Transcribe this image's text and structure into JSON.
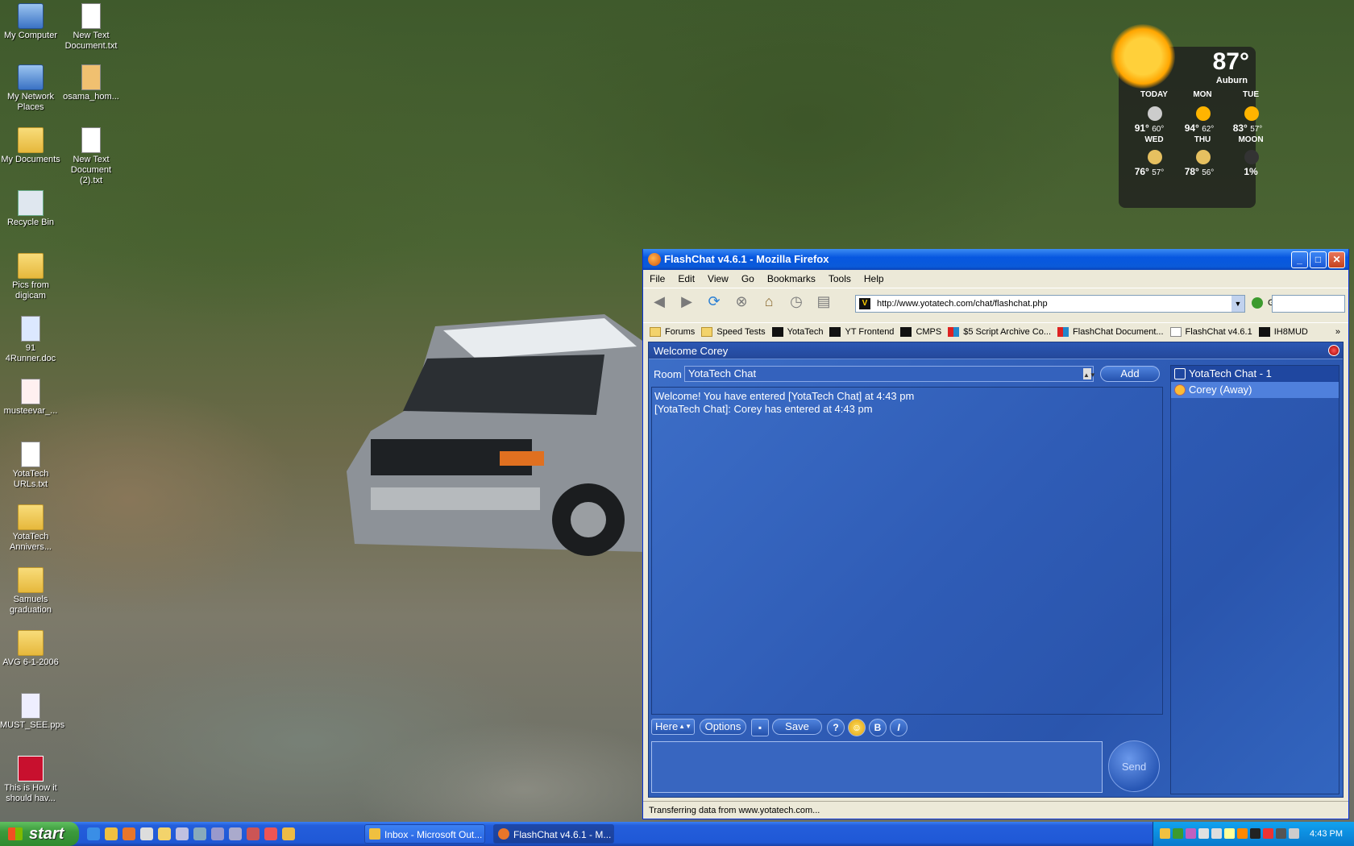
{
  "desktop": {
    "icons": [
      {
        "label": "My Computer"
      },
      {
        "label": "New Text Document.txt"
      },
      {
        "label": "My Network Places"
      },
      {
        "label": "osama_hom..."
      },
      {
        "label": "My Documents"
      },
      {
        "label": "New Text Document (2).txt"
      },
      {
        "label": "Recycle Bin"
      },
      {
        "label": "Pics from digicam"
      },
      {
        "label": "91 4Runner.doc"
      },
      {
        "label": "musteevar_..."
      },
      {
        "label": "YotaTech URLs.txt"
      },
      {
        "label": "YotaTech Annivers..."
      },
      {
        "label": "Samuels graduation"
      },
      {
        "label": "AVG 6-1-2006"
      },
      {
        "label": "MUST_SEE.pps"
      },
      {
        "label": "This is How it should hav..."
      }
    ]
  },
  "weather": {
    "current_temp": "87°",
    "location": "Auburn",
    "days": [
      {
        "name": "TODAY",
        "hi": "91°",
        "lo": "60°",
        "icon": "moon-icon"
      },
      {
        "name": "MON",
        "hi": "94°",
        "lo": "62°",
        "icon": "sun-icon"
      },
      {
        "name": "TUE",
        "hi": "83°",
        "lo": "57°",
        "icon": "sun-icon"
      },
      {
        "name": "WED",
        "hi": "76°",
        "lo": "57°",
        "icon": "partly-cloudy-icon"
      },
      {
        "name": "THU",
        "hi": "78°",
        "lo": "56°",
        "icon": "partly-cloudy-icon"
      },
      {
        "name": "MOON",
        "hi": "1%",
        "lo": "",
        "icon": "new-moon-icon"
      }
    ]
  },
  "browser": {
    "title": "FlashChat v4.6.1 - Mozilla Firefox",
    "menu": [
      "File",
      "Edit",
      "View",
      "Go",
      "Bookmarks",
      "Tools",
      "Help"
    ],
    "url": "http://www.yotatech.com/chat/flashchat.php",
    "go_label": "Go",
    "bookmarks": [
      {
        "label": "Forums",
        "icon": "folder-icon"
      },
      {
        "label": "Speed Tests",
        "icon": "folder-icon"
      },
      {
        "label": "YotaTech",
        "icon": "yotatech-icon"
      },
      {
        "label": "YT Frontend",
        "icon": "yotatech-icon"
      },
      {
        "label": "CMPS",
        "icon": "yotatech-icon"
      },
      {
        "label": "$5 Script Archive Co...",
        "icon": "site-icon"
      },
      {
        "label": "FlashChat Document...",
        "icon": "site-icon"
      },
      {
        "label": "FlashChat v4.6.1",
        "icon": "page-icon"
      },
      {
        "label": "IH8MUD",
        "icon": "site-icon"
      }
    ],
    "status": "Transferring data from www.yotatech.com..."
  },
  "chat": {
    "welcome": "Welcome Corey",
    "room_label": "Room",
    "room_selected": "YotaTech Chat",
    "add_label": "Add",
    "messages": [
      "Welcome! You have entered [YotaTech Chat] at 4:43 pm",
      "[YotaTech Chat]: Corey has entered at 4:43 pm"
    ],
    "room_list_item": "YotaTech Chat - 1",
    "user_list_item": "Corey (Away)",
    "status_select": "Here",
    "options_label": "Options",
    "save_label": "Save",
    "help_label": "?",
    "bold_label": "B",
    "italic_label": "I",
    "send_label": "Send",
    "accent": "#2f5cb6"
  },
  "taskbar": {
    "start_label": "start",
    "tasks": [
      {
        "label": "Inbox - Microsoft Out..."
      },
      {
        "label": "FlashChat v4.6.1 - M..."
      }
    ],
    "clock": "4:43 PM"
  }
}
